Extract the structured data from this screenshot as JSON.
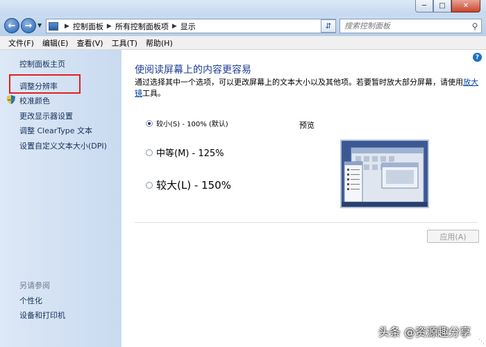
{
  "window": {
    "minimize_icon": "minimize-icon",
    "maximize_icon": "maximize-icon",
    "close_icon": "close-icon"
  },
  "address": {
    "breadcrumbs": [
      "控制面板",
      "所有控制面板项",
      "显示"
    ],
    "search_placeholder": "搜索控制面板"
  },
  "menu": [
    "文件(F)",
    "编辑(E)",
    "查看(V)",
    "工具(T)",
    "帮助(H)"
  ],
  "sidebar": {
    "links": [
      "控制面板主页",
      "调整分辨率",
      "校准颜色",
      "更改显示器设置",
      "调整 ClearType 文本",
      "设置自定义文本大小(DPI)"
    ],
    "see_also_title": "另请参阅",
    "see_also": [
      "个性化",
      "设备和打印机"
    ]
  },
  "main": {
    "heading": "使阅读屏幕上的内容更容易",
    "desc_prefix": "通过选择其中一个选项，可以更改屏幕上的文本大小以及其他项。若要暂时放大部分屏幕，请使用",
    "desc_link": "放大镜",
    "desc_suffix": "工具。",
    "options": [
      {
        "label": "较小(S) - 100% (默认)",
        "checked": true
      },
      {
        "label": "中等(M) - 125%",
        "checked": false
      },
      {
        "label": "较大(L) - 150%",
        "checked": false
      }
    ],
    "preview_label": "预览",
    "apply_label": "应用(A)"
  },
  "watermark": "头条 @资源趣分享",
  "colors": {
    "heading": "#1d3e94",
    "link": "#15305a",
    "highlight_box": "#e02020"
  }
}
